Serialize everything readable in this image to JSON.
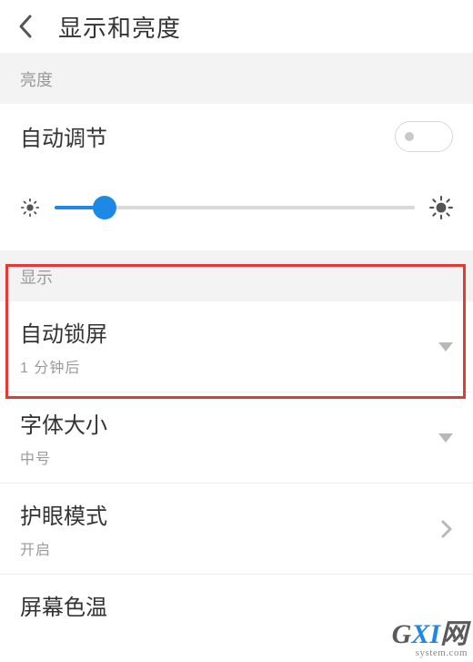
{
  "header": {
    "title": "显示和亮度"
  },
  "sections": {
    "brightness_header": "亮度",
    "display_header": "显示"
  },
  "auto_adjust": {
    "label": "自动调节",
    "enabled": false
  },
  "brightness_slider": {
    "value_percent": 14
  },
  "auto_lock": {
    "label": "自动锁屏",
    "value": "1 分钟后"
  },
  "font_size": {
    "label": "字体大小",
    "value": "中号"
  },
  "eye_care": {
    "label": "护眼模式",
    "value": "开启"
  },
  "color_temp": {
    "label": "屏幕色温"
  },
  "watermark": {
    "brand_g": "G",
    "brand_xi": "XI",
    "brand_suffix": "网",
    "url": "system.com"
  }
}
